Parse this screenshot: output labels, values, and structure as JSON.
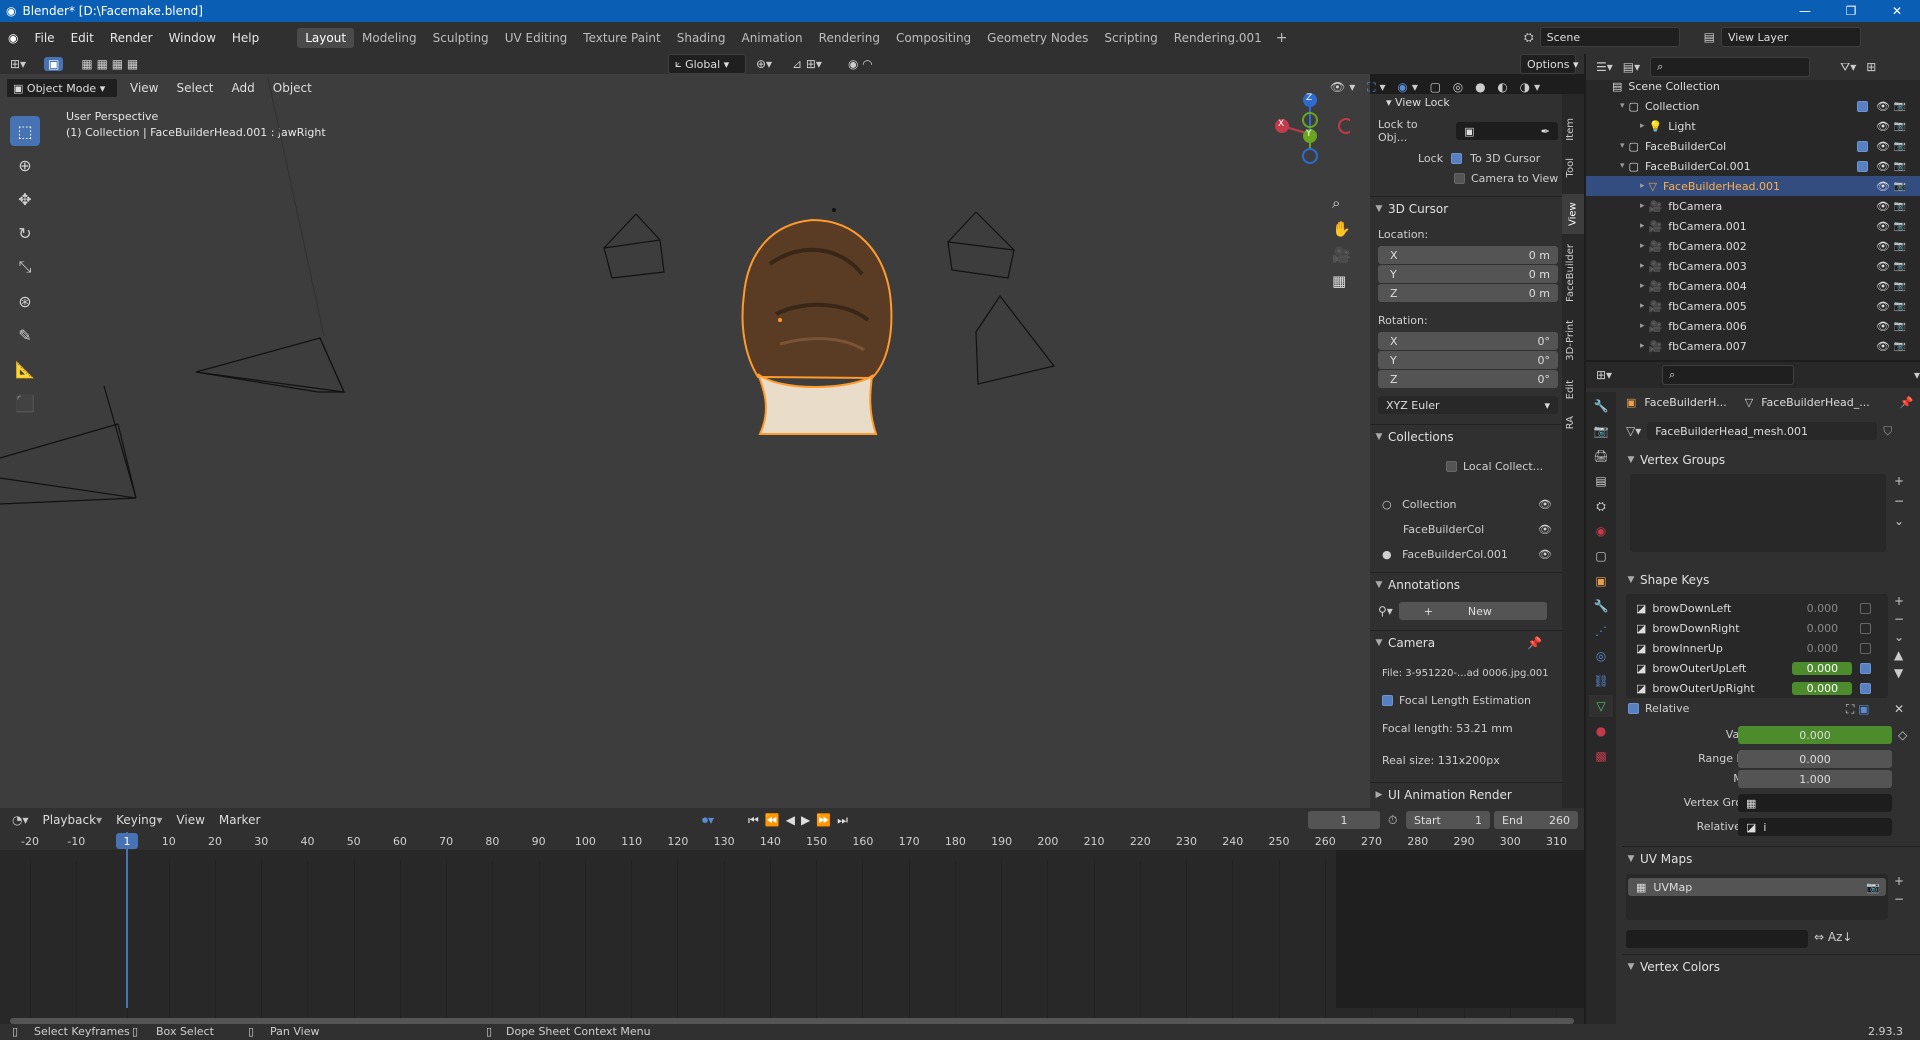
{
  "window": {
    "title": "Blender* [D:\\Facemake.blend]"
  },
  "menu": {
    "items": [
      "File",
      "Edit",
      "Render",
      "Window",
      "Help"
    ]
  },
  "workspaces": [
    "Layout",
    "Modeling",
    "Sculpting",
    "UV Editing",
    "Texture Paint",
    "Shading",
    "Animation",
    "Rendering",
    "Compositing",
    "Geometry Nodes",
    "Scripting",
    "Rendering.001"
  ],
  "active_workspace": "Layout",
  "scene": {
    "label": "Scene",
    "view_layer": "View Layer"
  },
  "viewport_header": {
    "mode": "Object Mode",
    "menus": [
      "View",
      "Select",
      "Add",
      "Object"
    ],
    "transform_orientation": "Global",
    "options": "Options"
  },
  "viewport": {
    "perspective": "User Perspective",
    "context": "(1) Collection | FaceBuilderHead.001 : jawRight",
    "gizmo": {
      "x": "X",
      "y": "Y",
      "z": "Z"
    }
  },
  "npanel": {
    "view_lock": {
      "title": "View Lock",
      "lock_to_obj": "Lock to Obj...",
      "lock": "Lock",
      "to_cursor": "To 3D Cursor",
      "to_cursor_checked": true,
      "camera_to_view": "Camera to View",
      "camera_to_view_checked": false
    },
    "cursor": {
      "title": "3D Cursor",
      "location": "Location:",
      "loc": [
        {
          "axis": "X",
          "value": "0 m"
        },
        {
          "axis": "Y",
          "value": "0 m"
        },
        {
          "axis": "Z",
          "value": "0 m"
        }
      ],
      "rotation": "Rotation:",
      "rot": [
        {
          "axis": "X",
          "value": "0°"
        },
        {
          "axis": "Y",
          "value": "0°"
        },
        {
          "axis": "Z",
          "value": "0°"
        }
      ],
      "mode": "XYZ Euler"
    },
    "collections": {
      "title": "Collections",
      "local": "Local Collect...",
      "items": [
        "Collection",
        "FaceBuilderCol",
        "FaceBuilderCol.001"
      ]
    },
    "annotations": {
      "title": "Annotations",
      "new": "New"
    },
    "camera": {
      "title": "Camera",
      "file": "File: 3-951220-...ad 0006.jpg.001",
      "focal_est": "Focal Length Estimation",
      "focal_est_checked": true,
      "focal_length": "Focal length: 53.21 mm",
      "real_size": "Real size: 131x200px"
    },
    "ui_anim": {
      "title": "UI Animation Render"
    },
    "tabs": [
      "Item",
      "Tool",
      "View",
      "FaceBuilder",
      "3D-Print",
      "Edit",
      "RA"
    ]
  },
  "outliner": {
    "root": "Scene Collection",
    "rows": [
      {
        "name": "Collection",
        "indent": 1,
        "type": "collection"
      },
      {
        "name": "Light",
        "indent": 2,
        "type": "light"
      },
      {
        "name": "FaceBuilderCol",
        "indent": 1,
        "type": "collection"
      },
      {
        "name": "FaceBuilderCol.001",
        "indent": 1,
        "type": "collection"
      },
      {
        "name": "FaceBuilderHead.001",
        "indent": 2,
        "type": "mesh",
        "selected": true
      },
      {
        "name": "fbCamera",
        "indent": 2,
        "type": "camera"
      },
      {
        "name": "fbCamera.001",
        "indent": 2,
        "type": "camera"
      },
      {
        "name": "fbCamera.002",
        "indent": 2,
        "type": "camera"
      },
      {
        "name": "fbCamera.003",
        "indent": 2,
        "type": "camera"
      },
      {
        "name": "fbCamera.004",
        "indent": 2,
        "type": "camera"
      },
      {
        "name": "fbCamera.005",
        "indent": 2,
        "type": "camera"
      },
      {
        "name": "fbCamera.006",
        "indent": 2,
        "type": "camera"
      },
      {
        "name": "fbCamera.007",
        "indent": 2,
        "type": "camera"
      }
    ]
  },
  "properties": {
    "breadcrumb": {
      "object": "FaceBuilderH...",
      "data": "FaceBuilderHead_..."
    },
    "mesh_name": "FaceBuilderHead_mesh.001",
    "vertex_groups": "Vertex Groups",
    "shape_keys": {
      "title": "Shape Keys",
      "items": [
        {
          "name": "browDownLeft",
          "value": "0.000",
          "on": false
        },
        {
          "name": "browDownRight",
          "value": "0.000",
          "on": false
        },
        {
          "name": "browInnerUp",
          "value": "0.000",
          "on": false
        },
        {
          "name": "browOuterUpLeft",
          "value": "0.000",
          "on": true
        },
        {
          "name": "browOuterUpRight",
          "value": "0.000",
          "on": true
        }
      ],
      "relative": "Relative",
      "value_label": "Value",
      "value": "0.000",
      "range_min_label": "Range Min",
      "range_min": "0.000",
      "max_label": "Max",
      "max": "1.000",
      "vertex_group_label": "Vertex Group",
      "relative_to_label": "Relative To",
      "relative_to": "i"
    },
    "uv_maps": {
      "title": "UV Maps",
      "items": [
        "UVMap"
      ]
    },
    "vertex_colors": "Vertex Colors"
  },
  "timeline": {
    "menus": [
      "Playback",
      "Keying",
      "View",
      "Marker"
    ],
    "current_frame": "1",
    "start_label": "Start",
    "start": "1",
    "end_label": "End",
    "end": "260",
    "ticks": [
      "-20",
      "-10",
      "1",
      "10",
      "20",
      "30",
      "40",
      "50",
      "60",
      "70",
      "80",
      "90",
      "100",
      "110",
      "120",
      "130",
      "140",
      "150",
      "160",
      "170",
      "180",
      "190",
      "200",
      "210",
      "220",
      "230",
      "240",
      "250",
      "260",
      "270",
      "280",
      "290",
      "300",
      "310"
    ]
  },
  "statusbar": {
    "items": [
      "Select Keyframes",
      "Box Select",
      "Pan View",
      "Dope Sheet Context Menu"
    ],
    "version": "2.93.3"
  },
  "colors": {
    "accent": "#4772b3",
    "selection": "#ff9a2e",
    "titlebar": "#0a5fb4",
    "green_field": "#4c8c2c"
  }
}
